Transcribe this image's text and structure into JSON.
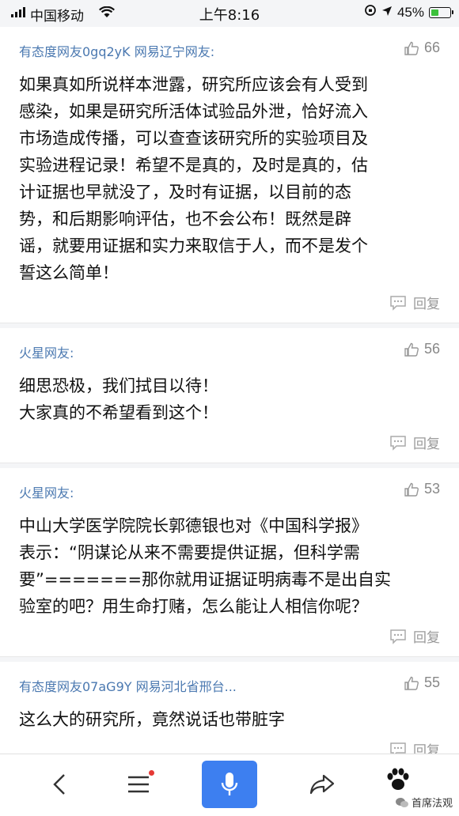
{
  "status_bar": {
    "carrier": "中国移动",
    "time": "上午8:16",
    "battery_percent": "45%",
    "battery_level": 0.45
  },
  "comments": [
    {
      "user": "有态度网友0gq2yK  网易辽宁网友:",
      "likes": "66",
      "lines": [
        "如果真如所说样本泄露，研究所应该会有人受到",
        "感染，如果是研究所活体试验品外泄，恰好流入",
        "市场造成传播，可以查查该研究所的实验项目及",
        "实验进程记录！希望不是真的，及时是真的，估",
        "计证据也早就没了，及时有证据，以目前的态",
        "势，和后期影响评估，也不会公布！既然是辟",
        "谣，就要用证据和实力来取信于人，而不是发个",
        "誓这么简单！"
      ],
      "reply_label": "回复"
    },
    {
      "user": "火星网友:",
      "likes": "56",
      "lines": [
        "细思恐极，我们拭目以待！",
        "大家真的不希望看到这个！"
      ],
      "reply_label": "回复"
    },
    {
      "user": "火星网友:",
      "likes": "53",
      "lines": [
        "中山大学医学院院长郭德银也对《中国科学报》",
        "表示：“阴谋论从来不需要提供证据，但科学需",
        "要”=======那你就用证据证明病毒不是出自实",
        "验室的吧？用生命打赌，怎么能让人相信你呢？"
      ],
      "reply_label": "回复"
    },
    {
      "user": "有态度网友07aG9Y  网易河北省邢台...",
      "likes": "55",
      "lines": [
        "这么大的研究所，竟然说话也带脏字"
      ],
      "reply_label": "回复"
    }
  ],
  "watermark": "首席法观",
  "colors": {
    "username": "#4a78b0",
    "mic_button": "#3d7ff0",
    "notification_dot": "#e53935",
    "battery": "#3cc13b"
  }
}
